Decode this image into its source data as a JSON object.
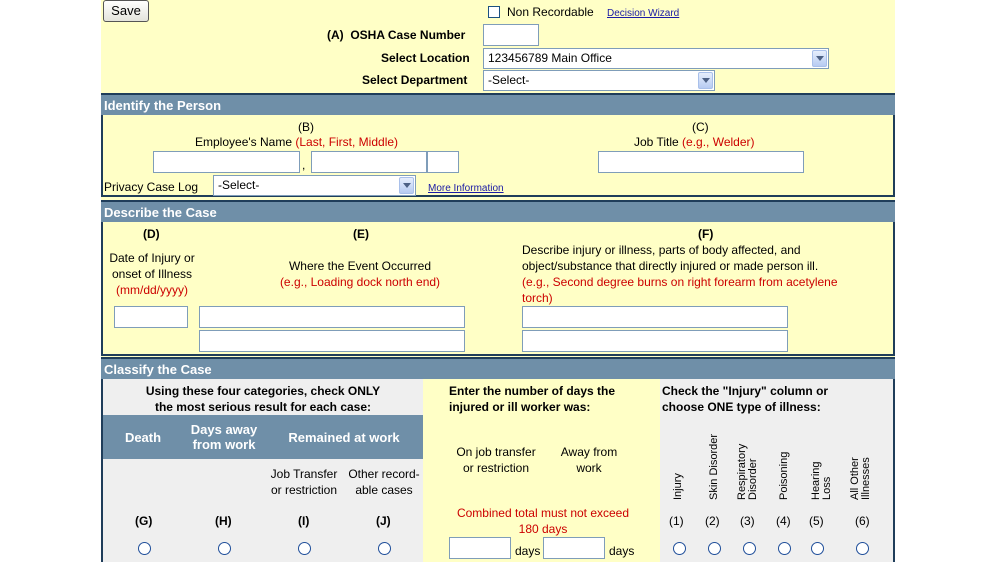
{
  "toolbar": {
    "save_label": "Save"
  },
  "top": {
    "non_recordable_label": "Non Recordable",
    "decision_wizard_link": "Decision Wizard",
    "case_number_label": "(A)  OSHA Case Number",
    "case_number_value": "",
    "location_label": "Select Location",
    "location_value": "123456789 Main Office",
    "department_label": "Select Department",
    "department_value": "-Select-"
  },
  "identify": {
    "title": "Identify the Person",
    "b_letter": "(B)",
    "employee_label": "Employee's Name",
    "employee_hint": "(Last, First, Middle)",
    "name_separator": ",",
    "c_letter": "(C)",
    "job_label": "Job Title",
    "job_hint": "(e.g., Welder)",
    "privacy_label": "Privacy Case Log",
    "privacy_value": "-Select-",
    "more_info_link": "More Information"
  },
  "describe": {
    "title": "Describe the Case",
    "d_letter": "(D)",
    "d_line1": "Date of Injury or",
    "d_line2": "onset of Illness",
    "d_hint": "(mm/dd/yyyy)",
    "e_letter": "(E)",
    "e_label": "Where the Event Occurred",
    "e_hint": "(e.g., Loading dock north end)",
    "f_letter": "(F)",
    "f_line1": "Describe injury or illness, parts of body affected, and",
    "f_line2": "object/substance that directly injured or made person ill.",
    "f_hint1": "(e.g., Second degree burns on right forearm from acetylene",
    "f_hint2": "torch)"
  },
  "classify": {
    "title": "Classify the Case",
    "left_heading1": "Using these four categories, check ONLY",
    "left_heading2": "the most serious result for each case:",
    "col_death": "Death",
    "col_days_away1": "Days away",
    "col_days_away2": "from work",
    "col_remained": "Remained at work",
    "sub_job_transfer1": "Job Transfer",
    "sub_job_transfer2": "or restriction",
    "sub_other1": "Other record-",
    "sub_other2": "able cases",
    "g": "(G)",
    "h": "(H)",
    "i": "(I)",
    "j": "(J)",
    "mid_heading1": "Enter the number of days the",
    "mid_heading2": "injured or ill worker was:",
    "mid_col1_1": "On job transfer",
    "mid_col1_2": "or restriction",
    "mid_col2_1": "Away from",
    "mid_col2_2": "work",
    "mid_warning1": "Combined total must not exceed",
    "mid_warning2": "180 days",
    "days_label": "days",
    "right_heading1": "Check the \"Injury\" column or",
    "right_heading2": "choose ONE type of illness:",
    "illness_cols": [
      "Injury",
      "Skin Disorder",
      "Respiratory Disorder",
      "Poisoning",
      "Hearing Loss",
      "All Other Illnesses"
    ],
    "illness_nums": [
      "(1)",
      "(2)",
      "(3)",
      "(4)",
      "(5)",
      "(6)"
    ]
  }
}
